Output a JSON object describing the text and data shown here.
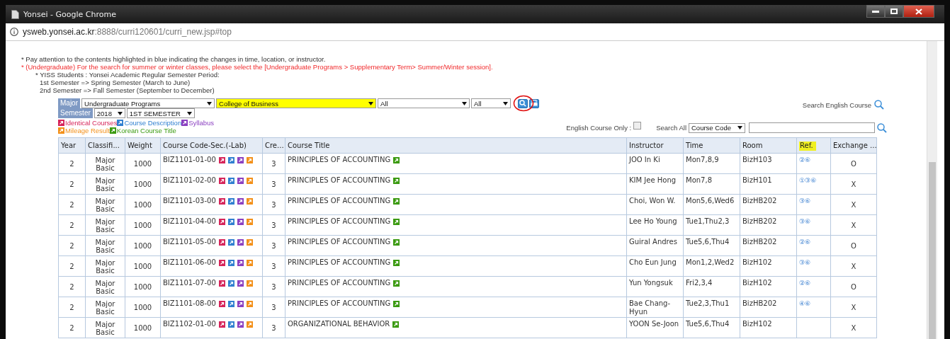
{
  "window": {
    "title": "Yonsei - Google Chrome"
  },
  "address_bar": {
    "host": "ysweb.yonsei.ac.kr",
    "path": ":8888/curri120601/curri_new.jsp#top"
  },
  "notes": [
    {
      "kind": "plain",
      "text": "* Pay attention to the contents highlighted in blue indicating the changes in time, location, or instructor."
    },
    {
      "kind": "warning",
      "text": "* (Undergraduate) For the search for summer or winter classes, please select the [Undergraduate Programs > Supplementary Term> Summer/Winter session]."
    },
    {
      "kind": "sub",
      "text": "* YISS Students : Yonsei Academic Regular Semester Period:"
    },
    {
      "kind": "subsub",
      "text": "1st Semester => Spring Semester (March to June)"
    },
    {
      "kind": "subsub",
      "text": "2nd Semester => Fall Semester (September to December)"
    }
  ],
  "filters": {
    "major_label": "Major",
    "major": [
      {
        "value": "Undergraduate Programs",
        "highlighted": false
      },
      {
        "value": "College of Business",
        "highlighted": true
      },
      {
        "value": "All",
        "highlighted": false
      },
      {
        "value": "All",
        "highlighted": false
      }
    ],
    "semester_label": "Semester",
    "year": "2018",
    "semester": "1ST SEMESTER"
  },
  "legend": [
    {
      "label": "Identical Courses",
      "color": "#d6245a"
    },
    {
      "label": "Course Description",
      "color": "#2f7fd0"
    },
    {
      "label": "Syllabus",
      "color": "#8a3fc0"
    },
    {
      "label": "Mileage Result",
      "color": "#f39019"
    },
    {
      "label": "Korean Course Title",
      "color": "#3a9a10"
    }
  ],
  "search_english_label": "Search English Course",
  "english_only": {
    "label": "English Course Only :",
    "checked": false
  },
  "search_all": {
    "label": "Search All",
    "field": "Course Code"
  },
  "table": {
    "columns": [
      {
        "label": "Year",
        "highlighted": false
      },
      {
        "label": "Classifi...",
        "highlighted": false
      },
      {
        "label": "Weight",
        "highlighted": false
      },
      {
        "label": "Course Code-Sec.(-Lab)",
        "highlighted": false
      },
      {
        "label": "Cre...",
        "highlighted": false
      },
      {
        "label": "Course Title",
        "highlighted": false
      },
      {
        "label": "Instructor",
        "highlighted": false
      },
      {
        "label": "Time",
        "highlighted": false
      },
      {
        "label": "Room",
        "highlighted": false
      },
      {
        "label": "Ref.",
        "highlighted": true
      },
      {
        "label": "Exchange ...",
        "highlighted": false
      }
    ],
    "rows": [
      {
        "year": "2",
        "classification": "Major Basic",
        "weight": "1000",
        "code": "BIZ1101-01-00",
        "credits": "3",
        "title": "PRINCIPLES OF ACCOUNTING",
        "instructor": "JOO In Ki",
        "time": "Mon7,8,9",
        "room": "BizH103",
        "ref": "②⑥",
        "exchange": "O"
      },
      {
        "year": "2",
        "classification": "Major Basic",
        "weight": "1000",
        "code": "BIZ1101-02-00",
        "credits": "3",
        "title": "PRINCIPLES OF ACCOUNTING",
        "instructor": "KIM Jee Hong",
        "time": "Mon7,8",
        "room": "BizH101",
        "ref": "①③⑥",
        "exchange": "X"
      },
      {
        "year": "2",
        "classification": "Major Basic",
        "weight": "1000",
        "code": "BIZ1101-03-00",
        "credits": "3",
        "title": "PRINCIPLES OF ACCOUNTING",
        "instructor": "Choi, Won W.",
        "time": "Mon5,6,Wed6",
        "room": "BizHB202",
        "ref": "③⑥",
        "exchange": "X"
      },
      {
        "year": "2",
        "classification": "Major Basic",
        "weight": "1000",
        "code": "BIZ1101-04-00",
        "credits": "3",
        "title": "PRINCIPLES OF ACCOUNTING",
        "instructor": "Lee Ho Young",
        "time": "Tue1,Thu2,3",
        "room": "BizHB202",
        "ref": "③⑥",
        "exchange": "X"
      },
      {
        "year": "2",
        "classification": "Major Basic",
        "weight": "1000",
        "code": "BIZ1101-05-00",
        "credits": "3",
        "title": "PRINCIPLES OF ACCOUNTING",
        "instructor": "Guiral Andres",
        "time": "Tue5,6,Thu4",
        "room": "BizHB202",
        "ref": "②⑥",
        "exchange": "O"
      },
      {
        "year": "2",
        "classification": "Major Basic",
        "weight": "1000",
        "code": "BIZ1101-06-00",
        "credits": "3",
        "title": "PRINCIPLES OF ACCOUNTING",
        "instructor": "Cho Eun Jung",
        "time": "Mon1,2,Wed2",
        "room": "BizH102",
        "ref": "③⑥",
        "exchange": "X"
      },
      {
        "year": "2",
        "classification": "Major Basic",
        "weight": "1000",
        "code": "BIZ1101-07-00",
        "credits": "3",
        "title": "PRINCIPLES OF ACCOUNTING",
        "instructor": "Yun Yongsuk",
        "time": "Fri2,3,4",
        "room": "BizH102",
        "ref": "②⑥",
        "exchange": "O"
      },
      {
        "year": "2",
        "classification": "Major Basic",
        "weight": "1000",
        "code": "BIZ1101-08-00",
        "credits": "3",
        "title": "PRINCIPLES OF ACCOUNTING",
        "instructor": "Bae Chang-Hyun",
        "time": "Tue2,3,Thu1",
        "room": "BizHB202",
        "ref": "④⑥",
        "exchange": "X"
      },
      {
        "year": "2",
        "classification": "Major Basic",
        "weight": "1000",
        "code": "BIZ1102-01-00",
        "credits": "3",
        "title": "ORGANIZATIONAL BEHAVIOR",
        "instructor": "YOON Se-Joon",
        "time": "Tue5,6,Thu4",
        "room": "BizH102",
        "exchange": "X"
      }
    ]
  }
}
